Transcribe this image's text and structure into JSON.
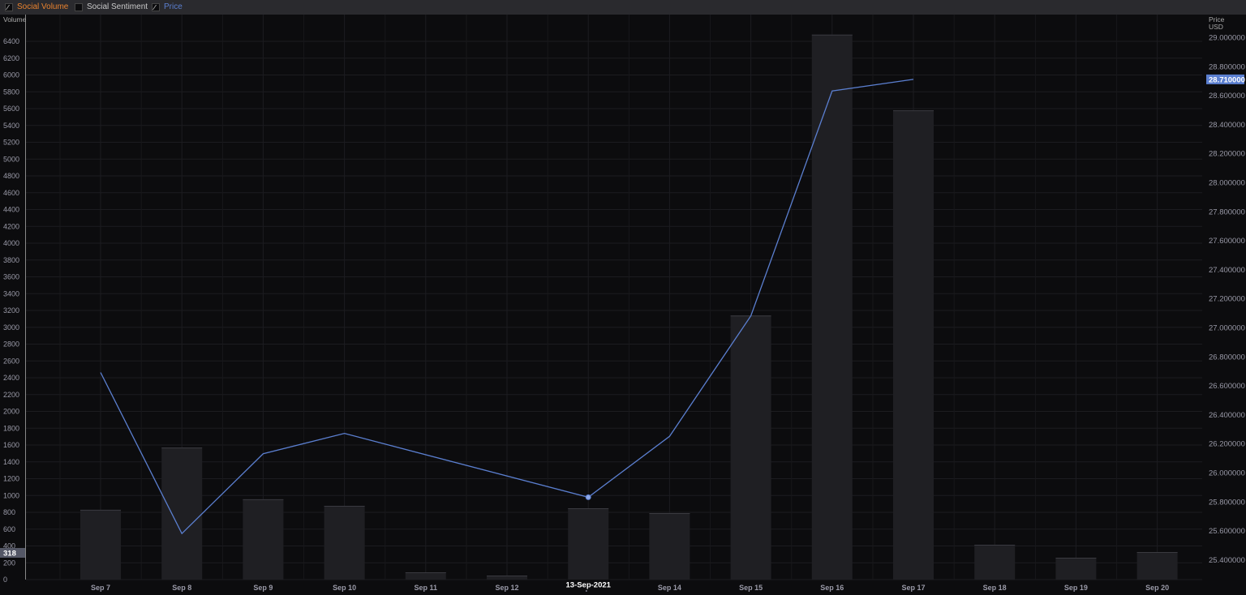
{
  "legend": [
    {
      "label": "Social Volume",
      "checked": true,
      "color": "#e8822e"
    },
    {
      "label": "Social Sentiment",
      "checked": false,
      "color": "#c8c8c8"
    },
    {
      "label": "Price",
      "checked": true,
      "color": "#5b7fd0"
    }
  ],
  "chart_data": {
    "type": "bar+line",
    "categories": [
      "Sep 7",
      "Sep 8",
      "Sep 9",
      "Sep 10",
      "Sep 11",
      "Sep 12",
      "Sep 13",
      "Sep 14",
      "Sep 15",
      "Sep 16",
      "Sep 17",
      "Sep 18",
      "Sep 19",
      "Sep 20"
    ],
    "series": [
      {
        "name": "Social Volume",
        "type": "bar",
        "axis": "left",
        "color": "#1f1f23",
        "values": [
          830,
          1570,
          955,
          877,
          87,
          48,
          848,
          790,
          3140,
          6480,
          5580,
          414,
          260,
          328
        ]
      },
      {
        "name": "Price",
        "type": "line",
        "axis": "right",
        "color": "#5b7fd0",
        "values": [
          26.69,
          25.58,
          26.13,
          26.27,
          null,
          null,
          25.83,
          26.25,
          27.08,
          28.63,
          28.71,
          null,
          null,
          null
        ]
      }
    ],
    "left_axis": {
      "label": "Volume",
      "ylim": [
        0,
        6400
      ],
      "ticks": [
        0,
        200,
        400,
        600,
        800,
        1000,
        1200,
        1400,
        1600,
        1800,
        2000,
        2200,
        2400,
        2600,
        2800,
        3000,
        3200,
        3400,
        3600,
        3800,
        4000,
        4200,
        4400,
        4600,
        4800,
        5000,
        5200,
        5400,
        5600,
        5800,
        6000,
        6200,
        6400
      ]
    },
    "right_axis": {
      "label": "Price",
      "unit": "USD",
      "ylim": [
        25.4,
        29.0
      ],
      "ticks": [
        "25.400000",
        "25.600000",
        "25.800000",
        "26.000000",
        "26.200000",
        "26.400000",
        "26.600000",
        "26.800000",
        "27.000000",
        "27.200000",
        "27.400000",
        "27.600000",
        "27.800000",
        "28.000000",
        "28.200000",
        "28.400000",
        "28.600000",
        "28.800000",
        "29.000000"
      ]
    },
    "last_price_label": "28.710000",
    "crosshair": {
      "date_label": "13-Sep-2021",
      "volume_label": "318",
      "category": "Sep 13"
    },
    "grid": true
  }
}
